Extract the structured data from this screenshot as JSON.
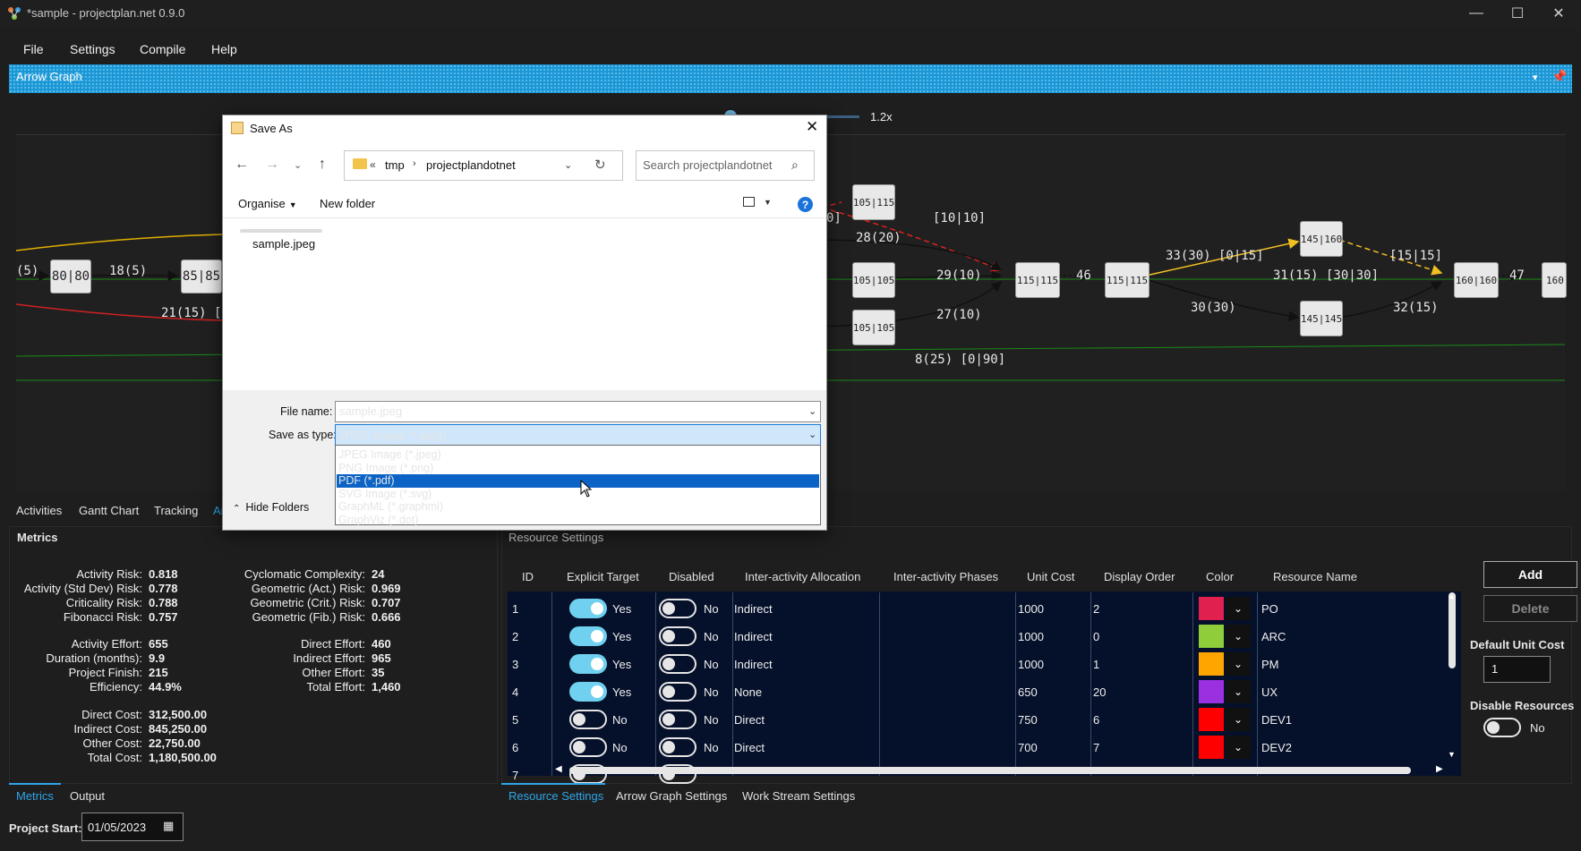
{
  "window": {
    "title": "*sample - projectplan.net 0.9.0"
  },
  "menu": [
    "File",
    "Settings",
    "Compile",
    "Help"
  ],
  "arrow_graph": {
    "title": "Arrow Graph",
    "zoom": "1.2x",
    "nodes": [
      "80|80",
      "85|85",
      "105|115",
      "105|105",
      "105|105",
      "115|115",
      "115|115",
      "145|160",
      "145|145",
      "160|160",
      "160"
    ],
    "edge_labels": [
      "(5)",
      "18(5)",
      "21(15) [5",
      "[10|10]",
      "28(20)",
      "29(10)",
      "27(10)",
      "8(25) [0|90]",
      "46",
      "33(30) [0|15]",
      "30(30)",
      "31(15) [30|30]",
      "[15|15]",
      "32(15)",
      "47",
      "0]"
    ]
  },
  "main_tabs": [
    "Activities",
    "Gantt Chart",
    "Tracking",
    "Ar"
  ],
  "metrics": {
    "title": "Metrics",
    "left": [
      {
        "label": "Activity Risk:",
        "value": "0.818"
      },
      {
        "label": "Activity (Std Dev) Risk:",
        "value": "0.778"
      },
      {
        "label": "Criticality Risk:",
        "value": "0.788"
      },
      {
        "label": "Fibonacci Risk:",
        "value": "0.757"
      },
      {
        "label": "Activity Effort:",
        "value": "655"
      },
      {
        "label": "Duration (months):",
        "value": "9.9"
      },
      {
        "label": "Project Finish:",
        "value": "215"
      },
      {
        "label": "Efficiency:",
        "value": "44.9%"
      },
      {
        "label": "Direct Cost:",
        "value": "312,500.00"
      },
      {
        "label": "Indirect Cost:",
        "value": "845,250.00"
      },
      {
        "label": "Other Cost:",
        "value": "22,750.00"
      },
      {
        "label": "Total Cost:",
        "value": "1,180,500.00"
      }
    ],
    "right": [
      {
        "label": "Cyclomatic Complexity:",
        "value": "24"
      },
      {
        "label": "Geometric (Act.) Risk:",
        "value": "0.969"
      },
      {
        "label": "Geometric (Crit.) Risk:",
        "value": "0.707"
      },
      {
        "label": "Geometric (Fib.) Risk:",
        "value": "0.666"
      },
      {
        "label": "Direct Effort:",
        "value": "460"
      },
      {
        "label": "Indirect Effort:",
        "value": "965"
      },
      {
        "label": "Other Effort:",
        "value": "35"
      },
      {
        "label": "Total Effort:",
        "value": "1,460"
      }
    ],
    "tabs": [
      "Metrics",
      "Output"
    ]
  },
  "resources": {
    "title": "Resource Settings",
    "headers": [
      "ID",
      "Explicit Target",
      "Disabled",
      "Inter-activity Allocation",
      "Inter-activity Phases",
      "Unit Cost",
      "Display Order",
      "Color",
      "Resource Name"
    ],
    "rows": [
      {
        "id": "1",
        "explicit": true,
        "explicit_label": "Yes",
        "disabled": false,
        "disabled_label": "No",
        "allocation": "Indirect",
        "unit_cost": "1000",
        "order": "2",
        "color": "#e0204f",
        "name": "PO"
      },
      {
        "id": "2",
        "explicit": true,
        "explicit_label": "Yes",
        "disabled": false,
        "disabled_label": "No",
        "allocation": "Indirect",
        "unit_cost": "1000",
        "order": "0",
        "color": "#8fce3a",
        "name": "ARC"
      },
      {
        "id": "3",
        "explicit": true,
        "explicit_label": "Yes",
        "disabled": false,
        "disabled_label": "No",
        "allocation": "Indirect",
        "unit_cost": "1000",
        "order": "1",
        "color": "#ffa500",
        "name": "PM"
      },
      {
        "id": "4",
        "explicit": true,
        "explicit_label": "Yes",
        "disabled": false,
        "disabled_label": "No",
        "allocation": "None",
        "unit_cost": "650",
        "order": "20",
        "color": "#9b30e0",
        "name": "UX"
      },
      {
        "id": "5",
        "explicit": false,
        "explicit_label": "No",
        "disabled": false,
        "disabled_label": "No",
        "allocation": "Direct",
        "unit_cost": "750",
        "order": "6",
        "color": "#ff0000",
        "name": "DEV1"
      },
      {
        "id": "6",
        "explicit": false,
        "explicit_label": "No",
        "disabled": false,
        "disabled_label": "No",
        "allocation": "Direct",
        "unit_cost": "700",
        "order": "7",
        "color": "#ff0000",
        "name": "DEV2"
      },
      {
        "id": "7"
      }
    ],
    "add_label": "Add",
    "delete_label": "Delete",
    "default_unit_cost_label": "Default Unit Cost",
    "default_unit_cost": "1",
    "disable_resources_label": "Disable Resources",
    "disable_resources_value": "No",
    "tabs": [
      "Resource Settings",
      "Arrow Graph Settings",
      "Work Stream Settings"
    ]
  },
  "project_start": {
    "label": "Project Start:",
    "value": "01/05/2023"
  },
  "dialog": {
    "title": "Save As",
    "path": [
      "tmp",
      "projectplandotnet"
    ],
    "search_placeholder": "Search projectplandotnet",
    "organise": "Organise",
    "new_folder": "New folder",
    "file_item": "sample.jpeg",
    "file_name_label": "File name:",
    "file_name": "sample.jpeg",
    "save_type_label": "Save as type:",
    "save_type": "JPEG Image (*.jpeg)",
    "type_options": [
      "JPEG Image (*.jpeg)",
      "PNG Image (*.png)",
      "PDF (*.pdf)",
      "SVG Image (*.svg)",
      "GraphML (*.graphml)",
      "GraphViz (*.dot)"
    ],
    "selected_option_index": 2,
    "hide_folders": "Hide Folders"
  },
  "colors": {
    "accent": "#1c97d6",
    "selection": "#0b63c6",
    "table_bg": "#05102a"
  }
}
